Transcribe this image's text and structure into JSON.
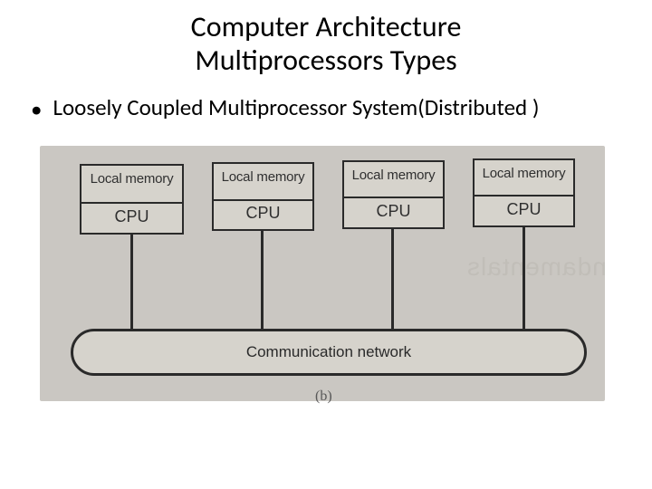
{
  "title_line1": "Computer Architecture",
  "title_line2": "Multiprocessors Types",
  "bullet1": "Loosely  Coupled Multiprocessor System(Distributed )",
  "diagram": {
    "ghost": "ndamentals",
    "net_label": "Communication network",
    "sub": "(b)",
    "nodes": [
      {
        "mem": "Local memory",
        "cpu": "CPU"
      },
      {
        "mem": "Local memory",
        "cpu": "CPU"
      },
      {
        "mem": "Local memory",
        "cpu": "CPU"
      },
      {
        "mem": "Local memory",
        "cpu": "CPU"
      }
    ]
  }
}
